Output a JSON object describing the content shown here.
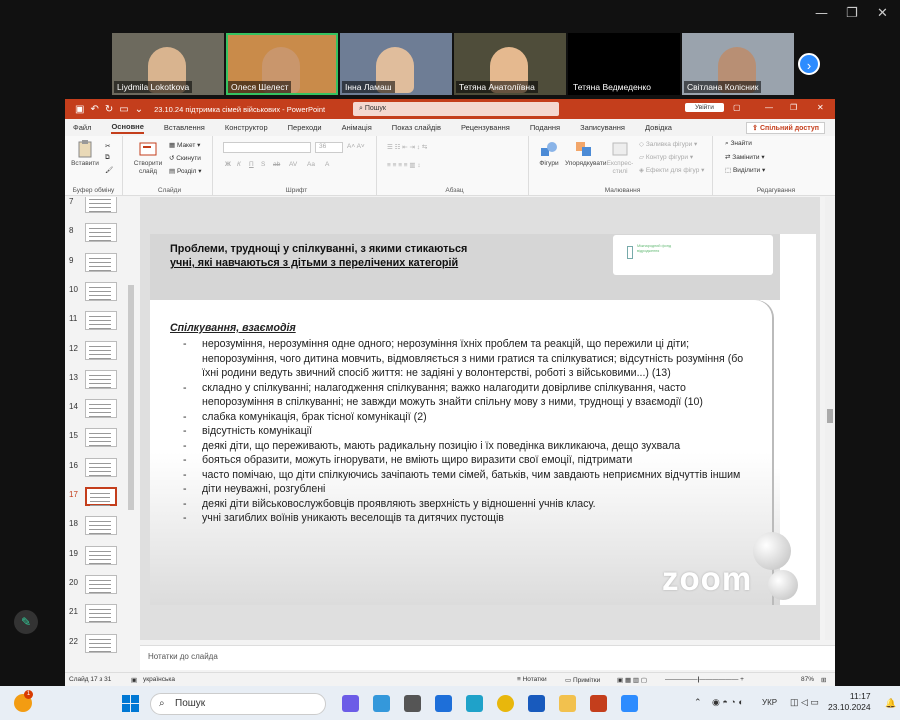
{
  "zoom": {
    "participants": [
      {
        "name": "Liydmila Lokotkova",
        "bg": "#6d6a5e",
        "skin": "#d9b48f"
      },
      {
        "name": "Олеся Шелест",
        "bg": "#c98b4a",
        "skin": "#c9966c",
        "active": true
      },
      {
        "name": "Інна Ламаш",
        "bg": "#6e7d95",
        "skin": "#e0bd9c"
      },
      {
        "name": "Тетяна Анатоліївна",
        "bg": "#4f4d3a",
        "skin": "#e5b98f"
      },
      {
        "name": "Тетяна Ведмеденко",
        "bg": "#000000",
        "skin": "#000000"
      },
      {
        "name": "Світлана Колісник",
        "bg": "#9aa3ad",
        "skin": "#b88f74"
      }
    ],
    "next_icon": "chevron-right-icon"
  },
  "ppt": {
    "doc_title": "23.10.24 підтримка сімей військових  -  PowerPoint",
    "search_placeholder": "Пошук",
    "sign_in": "Увійти",
    "tabs": [
      "Файл",
      "Основне",
      "Вставлення",
      "Конструктор",
      "Переходи",
      "Анімація",
      "Показ слайдів",
      "Рецензування",
      "Подання",
      "Записування",
      "Довідка"
    ],
    "selected_tab": "Основне",
    "share": "Спільний доступ",
    "ribbon": {
      "paste": "Вставити",
      "clipboard": "Буфер обміну",
      "new_slide": "Створити слайд",
      "layout": "Макет",
      "reset": "Скинути",
      "section": "Розділ",
      "slides": "Слайди",
      "font": "Шрифт",
      "font_size": "36",
      "paragraph": "Абзац",
      "shapes": "Фігури",
      "arrange": "Упорядкувати",
      "quick_styles": "Експрес-стилі",
      "shape_fill": "Заливка фігури",
      "shape_outline": "Контур фігури",
      "shape_effects": "Ефекти для фігур",
      "drawing": "Малювання",
      "find": "Знайти",
      "replace": "Замінити",
      "select": "Виділити",
      "editing": "Редагування"
    },
    "thumbnails": [
      "7",
      "8",
      "9",
      "10",
      "11",
      "12",
      "13",
      "14",
      "15",
      "16",
      "17",
      "18",
      "19",
      "20",
      "21",
      "22"
    ],
    "selected_slide": "17",
    "slide": {
      "title_line1": "Проблеми, труднощі у спілкуванні, з якими стикаються",
      "title_line2": "учні, які навчаються з дітьми з перелічених категорій",
      "logo_text": "Міжнародний фонд відродження",
      "section": "Спілкування, взаємодія",
      "bullets": [
        "нерозуміння, нерозуміння одне одного; нерозуміння їхніх проблем та реакцій, що пережили ці діти; непорозуміння, чого дитина мовчить, відмовляється з ними гратися та спілкуватися; відсутність розуміння (бо їхні родини ведуть звичний спосіб життя: не задіяні у волонтерстві, роботі з військовими...) (13)",
        "складно у спілкуванні; налагодження спілкування; важко налагодити довірливе спілкування, часто непорозуміння в спілкуванні; не завжди можуть знайти спільну мову з ними, труднощі у взаємодії (10)",
        "слабка комунікація, брак тісної комунікації (2)",
        "відсутність комунікації",
        "деякі діти, що переживають, мають радикальну позицію і їх поведінка викликаюча, дещо зухвала",
        "бояться образити, можуть ігнорувати, не вміють щиро виразити свої емоції, підтримати",
        "часто помічаю, що діти спілкуючись зачіпають теми сімей, батьків, чим завдають неприємних відчуттів іншим",
        "діти неуважні, розгублені",
        "деякі діти військовослужбовців проявляють зверхність у відношенні учнів класу.",
        "учні загиблих воїнів уникають веселощів та дитячих пустощів"
      ],
      "watermark": "zoom"
    },
    "notes_placeholder": "Нотатки до слайда",
    "status": {
      "slide_of": "Слайд 17 з 31",
      "language": "українська",
      "notes": "Нотатки",
      "comments": "Примітки",
      "zoom": "87%"
    }
  },
  "taskbar": {
    "search": "Пошук",
    "lang": "УКР",
    "time": "11:17",
    "date": "23.10.2024",
    "badge": "1"
  }
}
